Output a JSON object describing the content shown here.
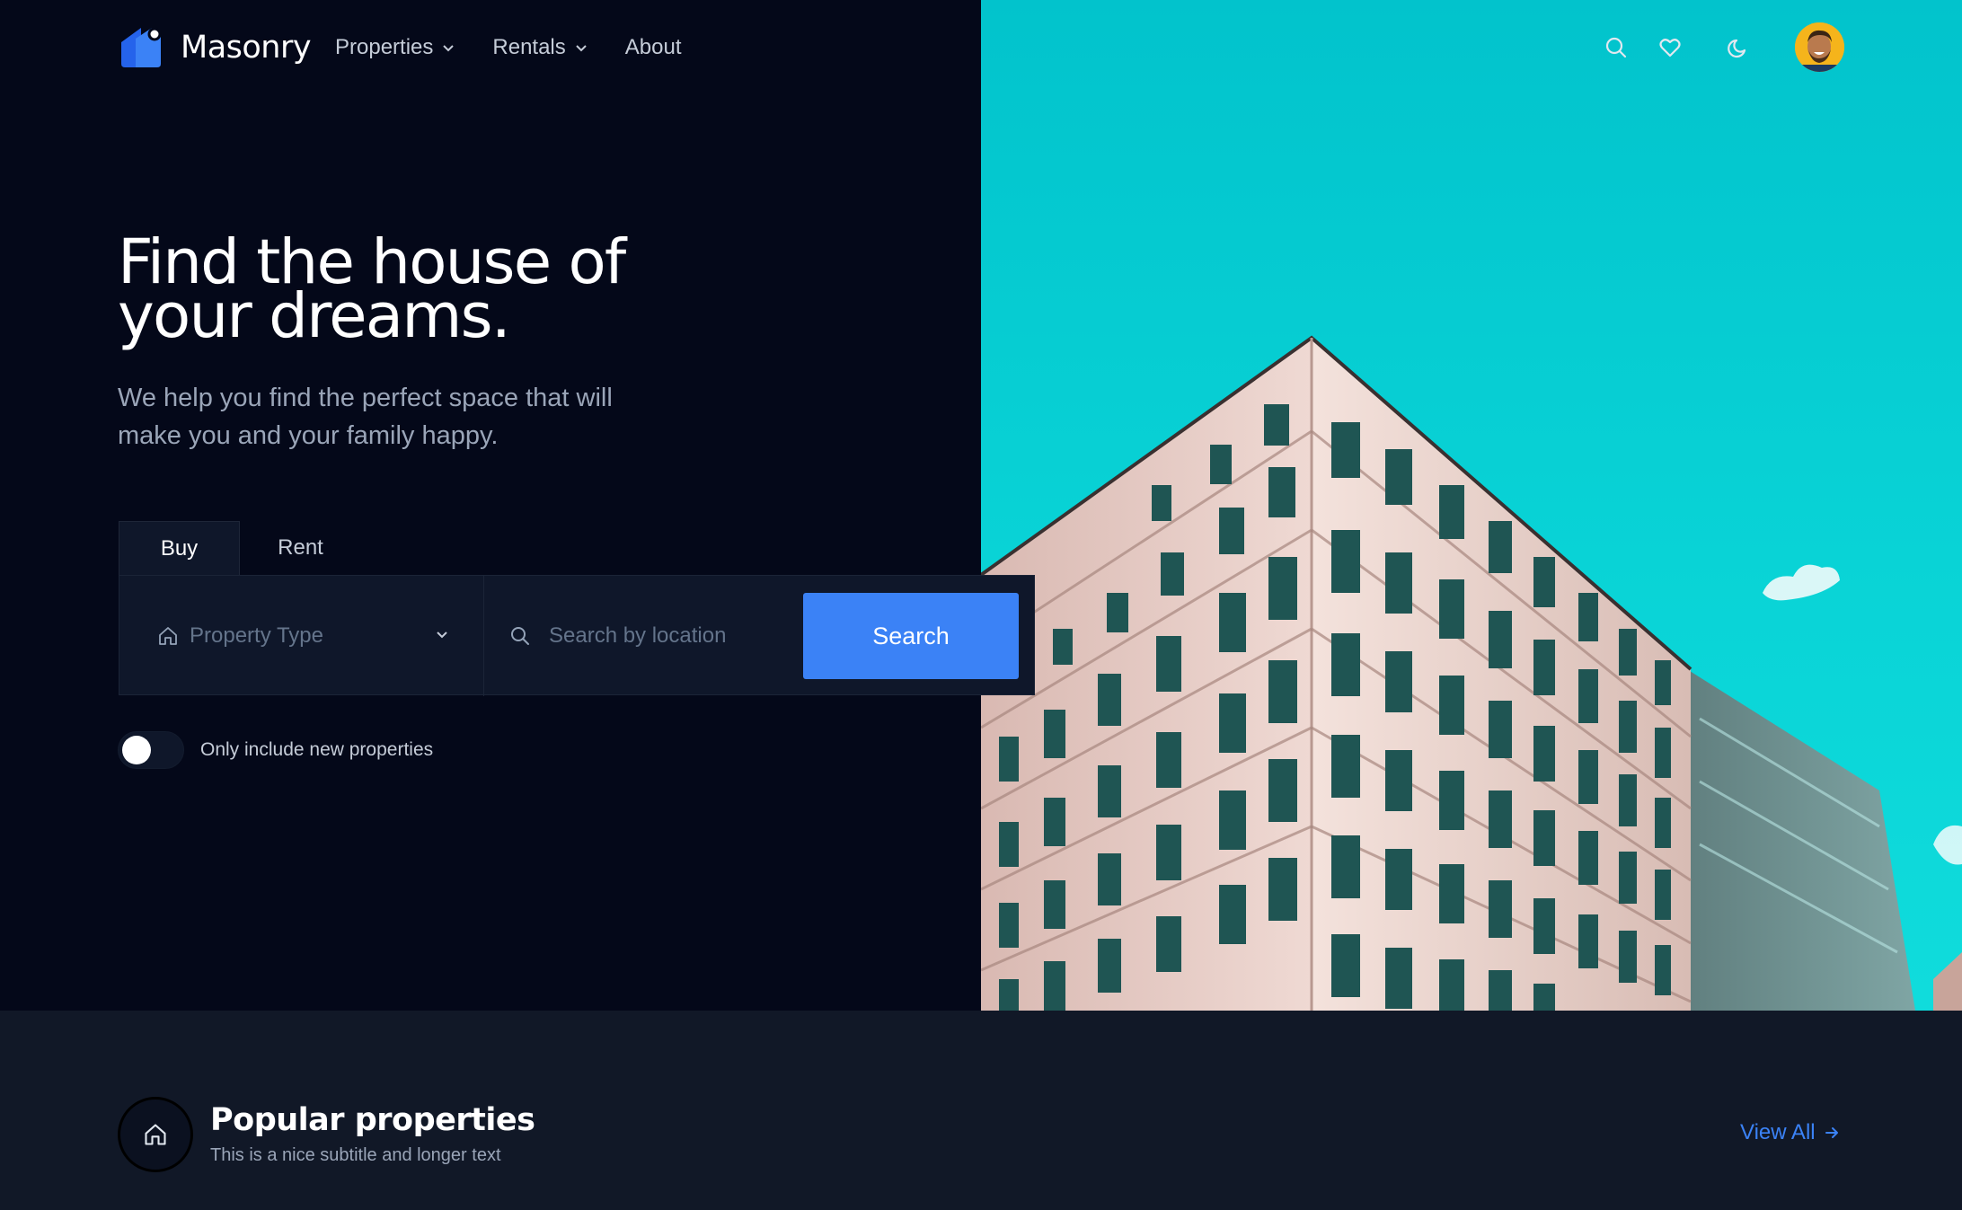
{
  "brand": {
    "name": "Masonry"
  },
  "nav": {
    "items": [
      {
        "label": "Properties",
        "has_dropdown": true
      },
      {
        "label": "Rentals",
        "has_dropdown": true
      },
      {
        "label": "About",
        "has_dropdown": false
      }
    ],
    "icons": [
      "search-icon",
      "heart-icon",
      "moon-icon"
    ]
  },
  "hero": {
    "headline_line1": "Find the house of",
    "headline_line2": "your dreams.",
    "subtitle": "We help you find the perfect space that will make you and your family happy."
  },
  "search": {
    "tabs": [
      {
        "label": "Buy",
        "active": true
      },
      {
        "label": "Rent",
        "active": false
      }
    ],
    "property_type_placeholder": "Property Type",
    "location_placeholder": "Search by location",
    "button_label": "Search"
  },
  "filter": {
    "new_only_label": "Only include new properties",
    "new_only_enabled": false
  },
  "popular": {
    "title": "Popular properties",
    "subtitle": "This is a nice subtitle and longer text",
    "view_all_label": "View All"
  },
  "colors": {
    "accent": "#3b82f6",
    "hero_bg": "#040819",
    "panel_bg": "#0f172a",
    "section_bg": "#111827",
    "sky": "#09d3d6"
  }
}
